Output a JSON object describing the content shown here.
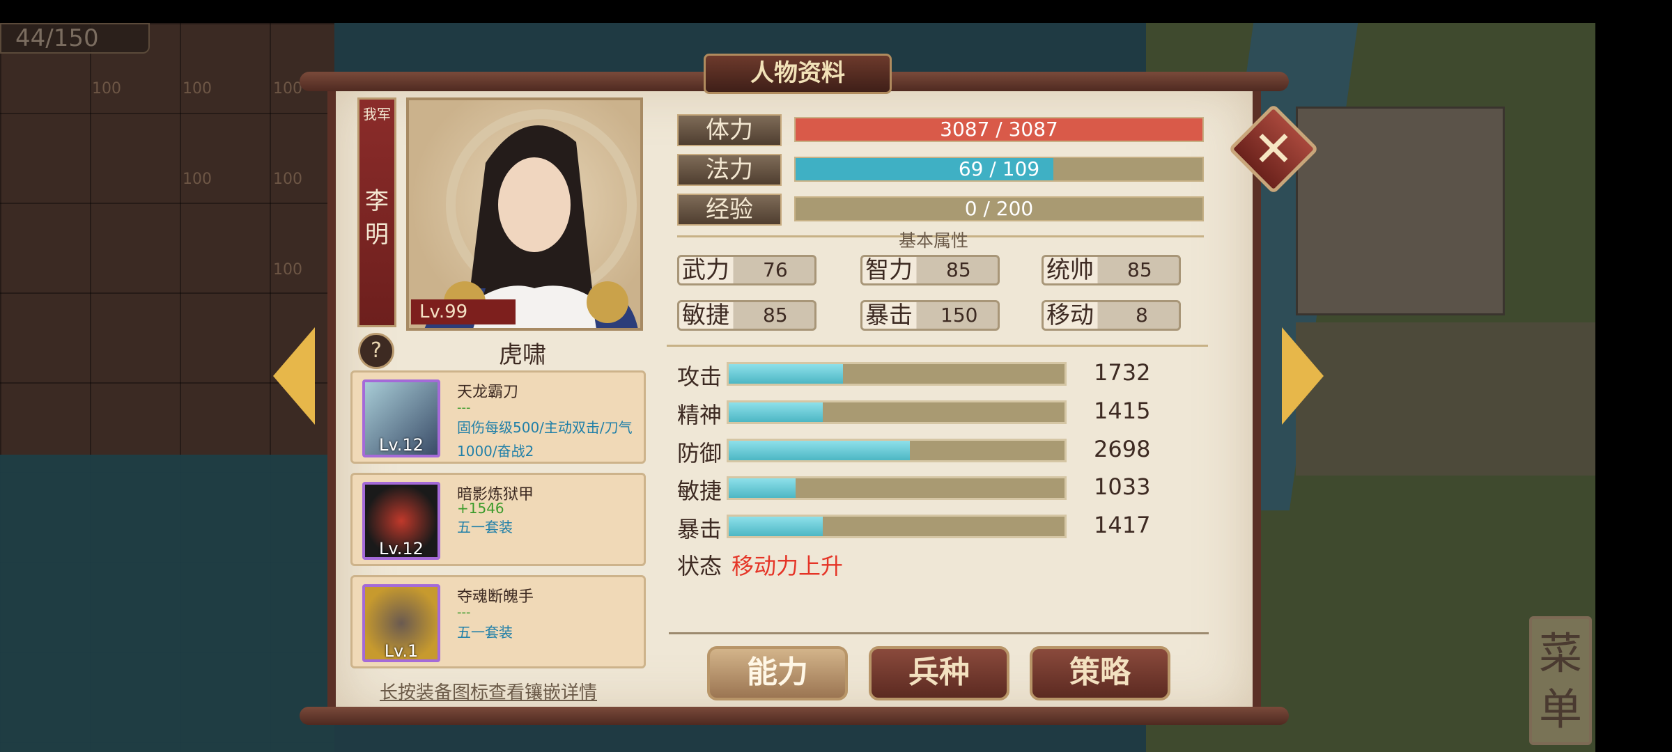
{
  "map": {
    "counter": "44/150",
    "cell_labels": [
      "100",
      "100",
      "100",
      "100",
      "100",
      "100"
    ],
    "menu_label": "菜单"
  },
  "panel": {
    "title": "人物资料",
    "banner_camp": "我军",
    "hero_name": "李明",
    "level": "Lv.99",
    "hero_title": "虎啸",
    "help_label": "?"
  },
  "bars": [
    {
      "label": "体力",
      "value": "3087 / 3087",
      "fill": 1.0,
      "color": "#d95a49"
    },
    {
      "label": "法力",
      "value": "69 / 109",
      "fill": 0.633,
      "color": "#3fb0c4"
    },
    {
      "label": "经验",
      "value": "0 / 200",
      "fill": 0.0,
      "color": "#3fb0c4"
    }
  ],
  "basic_header": "基本属性",
  "attributes": [
    {
      "name": "武力",
      "value": "76"
    },
    {
      "name": "智力",
      "value": "85"
    },
    {
      "name": "统帅",
      "value": "85"
    },
    {
      "name": "敏捷",
      "value": "85"
    },
    {
      "name": "暴击",
      "value": "150"
    },
    {
      "name": "移动",
      "value": "8"
    }
  ],
  "combat": [
    {
      "name": "攻击",
      "value": "1732",
      "fill": 0.34
    },
    {
      "name": "精神",
      "value": "1415",
      "fill": 0.28
    },
    {
      "name": "防御",
      "value": "2698",
      "fill": 0.54
    },
    {
      "name": "敏捷",
      "value": "1033",
      "fill": 0.2
    },
    {
      "name": "暴击",
      "value": "1417",
      "fill": 0.28
    }
  ],
  "status": {
    "label": "状态",
    "value": "移动力上升"
  },
  "equipment": [
    {
      "name": "天龙霸刀",
      "line2": "---",
      "detail": "固伤每级500/主动双击/刀气1000/奋战2",
      "level": "Lv.12",
      "frame": "#a46ad8"
    },
    {
      "name": "暗影炼狱甲",
      "line2": "+1546",
      "detail": "五一套装",
      "level": "Lv.12",
      "frame": "#a46ad8"
    },
    {
      "name": "夺魂断魄手",
      "line2": "---",
      "detail": "五一套装",
      "level": "Lv.1",
      "frame": "#a46ad8"
    }
  ],
  "equip_hint": "长按装备图标查看镶嵌详情",
  "tabs": [
    "能力",
    "兵种",
    "策略"
  ],
  "close_symbol": "✕"
}
